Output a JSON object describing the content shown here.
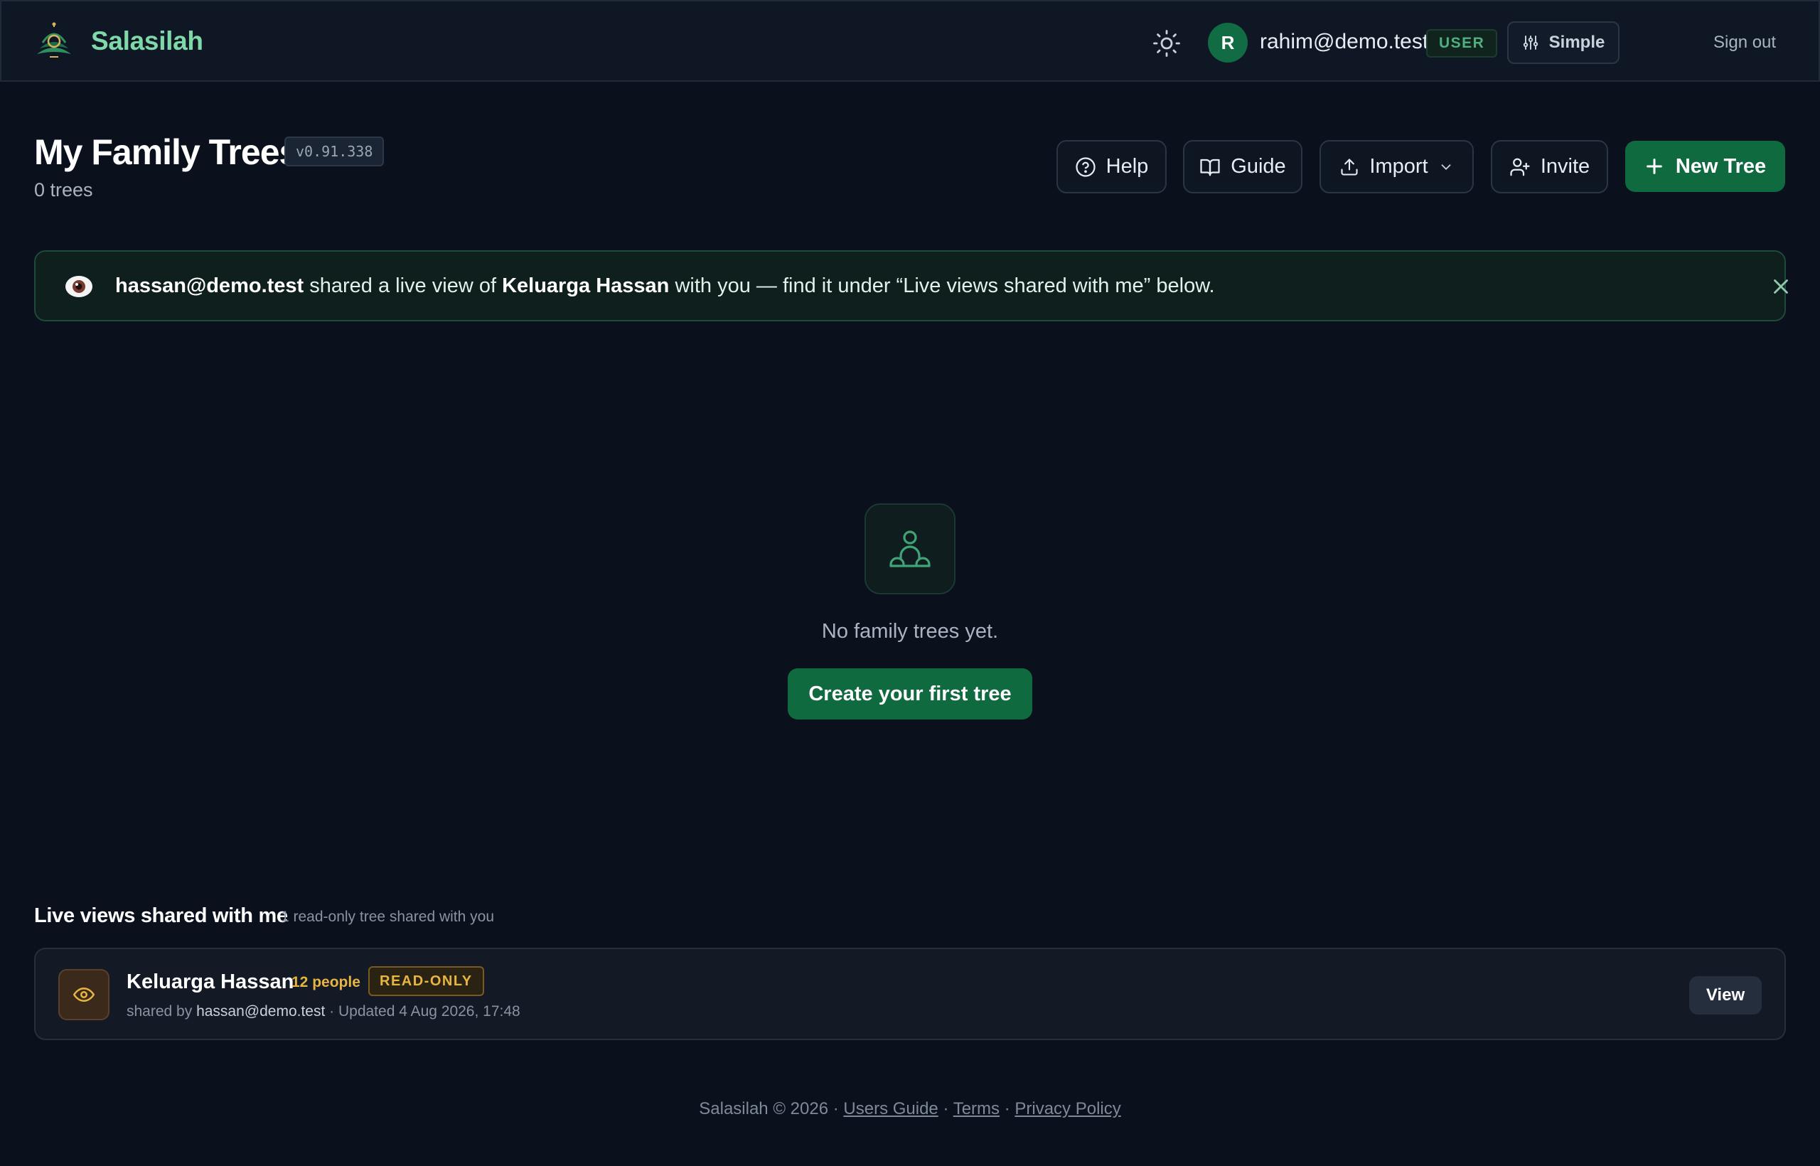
{
  "brand": {
    "name": "Salasilah"
  },
  "user": {
    "avatar_initial": "R",
    "email": "rahim@demo.test",
    "role": "USER",
    "mode_label": "Simple",
    "signout_label": "Sign out"
  },
  "page": {
    "title": "My Family Trees",
    "version": "v0.91.338",
    "tree_count": "0 trees"
  },
  "actions": {
    "help": "Help",
    "guide": "Guide",
    "import": "Import",
    "invite": "Invite",
    "new_tree": "New Tree"
  },
  "notice": {
    "sharer": "hassan@demo.test",
    "text1": " shared a live view of ",
    "tree_name": "Keluarga Hassan",
    "text2": " with you — find it under “Live views shared with me” below."
  },
  "empty_state": {
    "message": "No family trees yet.",
    "cta": "Create your first tree"
  },
  "shared_section": {
    "title": "Live views shared with me",
    "subtitle": "1 read-only tree shared with you",
    "items": [
      {
        "name": "Keluarga Hassan",
        "people": "12 people",
        "badge": "READ-ONLY",
        "shared_by_prefix": "shared by ",
        "shared_by": "hassan@demo.test",
        "updated": " · Updated 4 Aug 2026, 17:48",
        "view_label": "View"
      }
    ]
  },
  "footer": {
    "copyright": "Salasilah © 2026",
    "sep": " · ",
    "links": [
      "Users Guide",
      "Terms",
      "Privacy Policy"
    ]
  },
  "colors": {
    "background": "#0b111c",
    "accent_green": "#0f6a40",
    "brand_text": "#7fd8a8",
    "warning_amber": "#e8b640"
  }
}
